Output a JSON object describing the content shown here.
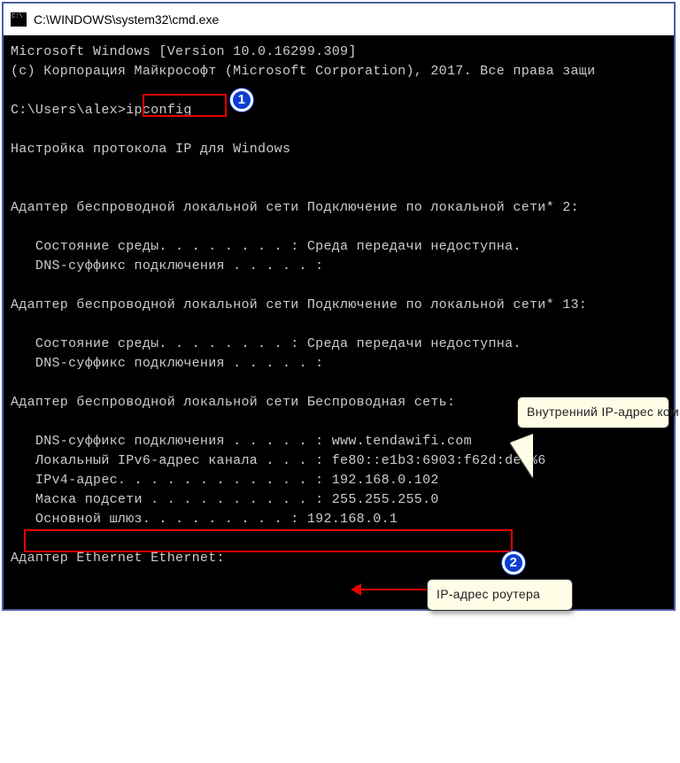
{
  "window": {
    "title": "C:\\WINDOWS\\system32\\cmd.exe"
  },
  "terminal": {
    "line1": "Microsoft Windows [Version 10.0.16299.309]",
    "line2": "(c) Корпорация Майкрософт (Microsoft Corporation), 2017. Все права защи",
    "prompt_path": "C:\\Users\\alex>",
    "command": "ipconfig",
    "heading": "Настройка протокола IP для Windows",
    "adapter1_title": "Адаптер беспроводной локальной сети Подключение по локальной сети* 2:",
    "adapter1_line1": "   Состояние среды. . . . . . . . : Среда передачи недоступна.",
    "adapter1_line2": "   DNS-суффикс подключения . . . . . :",
    "adapter2_title": "Адаптер беспроводной локальной сети Подключение по локальной сети* 13:",
    "adapter2_line1": "   Состояние среды. . . . . . . . : Среда передачи недоступна.",
    "adapter2_line2": "   DNS-суффикс подключения . . . . . :",
    "adapter3_title": "Адаптер беспроводной локальной сети Беспроводная сеть:",
    "adapter3_line1": "   DNS-суффикс подключения . . . . . : www.tendawifi.com",
    "adapter3_line2": "   Локальный IPv6-адрес канала . . . : fe80::e1b3:6903:f62d:de5%6",
    "adapter3_line3": "   IPv4-адрес. . . . . . . . . . . . : 192.168.0.102",
    "adapter3_line4": "   Маска подсети . . . . . . . . . . : 255.255.255.0",
    "adapter3_line5": "   Основной шлюз. . . . . . . . . : 192.168.0.1",
    "adapter4_title": "Адаптер Ethernet Ethernet:"
  },
  "annotations": {
    "badge1": "1",
    "badge2": "2",
    "callout1": "Внутренний IP-адрес компьютера",
    "callout2": "IP-адрес роутера"
  }
}
